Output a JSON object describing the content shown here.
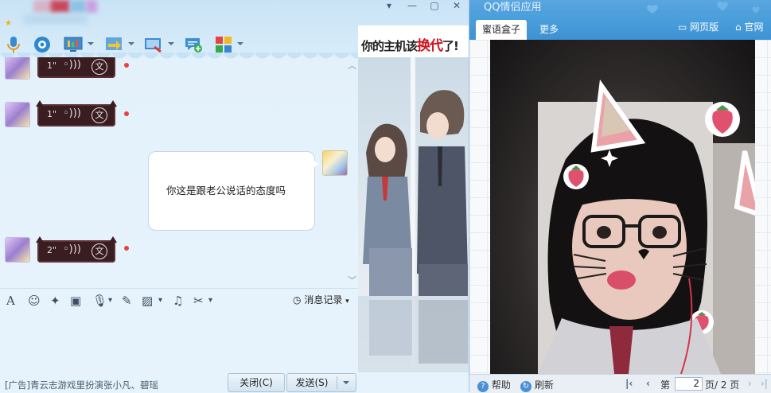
{
  "chat": {
    "messages": [
      {
        "type": "voice",
        "duration": "1\"",
        "translate_label": "文"
      },
      {
        "type": "voice",
        "duration": "1\"",
        "translate_label": "文"
      },
      {
        "type": "text",
        "text": "你这是跟老公说话的态度吗"
      },
      {
        "type": "voice",
        "duration": "2\"",
        "translate_label": "文"
      }
    ],
    "history_label": "消息记录",
    "ad_text": "[广告]青云志游戏里扮演张小凡、碧瑶",
    "close_button": "关闭(C)",
    "send_button": "发送(S)",
    "ad_panel_title_prefix": "你的主机该",
    "ad_panel_title_highlight": "换代",
    "ad_panel_title_suffix": "了!",
    "colors": {
      "voice_bubble": "#3a1d20",
      "unread_dot": "#e8423a",
      "accent": "#4b9bd9"
    }
  },
  "app": {
    "title": "QQ情侣应用",
    "tabs": [
      "蜜语盒子",
      "更多"
    ],
    "web_version": "网页版",
    "official": "官网",
    "footer": {
      "help": "帮助",
      "refresh": "刷新",
      "page_prefix": "第",
      "current_page": "2",
      "page_suffix": "页/ 2 页"
    }
  }
}
